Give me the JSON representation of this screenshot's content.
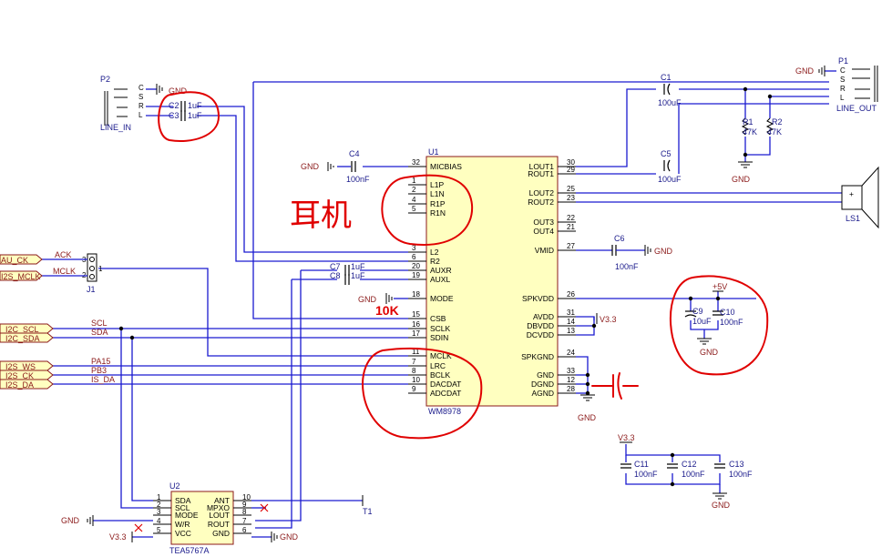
{
  "u1": {
    "ref": "U1",
    "name": "WM8978",
    "left_pins": [
      {
        "num": "32",
        "name": "MICBIAS"
      },
      {
        "num": "1",
        "name": "L1P"
      },
      {
        "num": "2",
        "name": "L1N"
      },
      {
        "num": "4",
        "name": "R1P"
      },
      {
        "num": "5",
        "name": "R1N"
      },
      {
        "num": "3",
        "name": "L2"
      },
      {
        "num": "6",
        "name": "R2"
      },
      {
        "num": "20",
        "name": "AUXR"
      },
      {
        "num": "19",
        "name": "AUXL"
      },
      {
        "num": "18",
        "name": "MODE"
      },
      {
        "num": "15",
        "name": "CSB"
      },
      {
        "num": "16",
        "name": "SCLK"
      },
      {
        "num": "17",
        "name": "SDIN"
      },
      {
        "num": "11",
        "name": "MCLK"
      },
      {
        "num": "7",
        "name": "LRC"
      },
      {
        "num": "8",
        "name": "BCLK"
      },
      {
        "num": "10",
        "name": "DACDAT"
      },
      {
        "num": "9",
        "name": "ADCDAT"
      }
    ],
    "right_pins": [
      {
        "num": "30",
        "name": "LOUT1"
      },
      {
        "num": "29",
        "name": "ROUT1"
      },
      {
        "num": "25",
        "name": "LOUT2"
      },
      {
        "num": "23",
        "name": "ROUT2"
      },
      {
        "num": "22",
        "name": "OUT3"
      },
      {
        "num": "21",
        "name": "OUT4"
      },
      {
        "num": "27",
        "name": "VMID"
      },
      {
        "num": "26",
        "name": "SPKVDD"
      },
      {
        "num": "31",
        "name": "AVDD"
      },
      {
        "num": "14",
        "name": "DBVDD"
      },
      {
        "num": "13",
        "name": "DCVDD"
      },
      {
        "num": "24",
        "name": "SPKGND"
      },
      {
        "num": "33",
        "name": "GND"
      },
      {
        "num": "12",
        "name": "DGND"
      },
      {
        "num": "28",
        "name": "AGND"
      }
    ]
  },
  "u2": {
    "ref": "U2",
    "name": "TEA5767A",
    "left_pins": [
      {
        "num": "1",
        "name": "SDA"
      },
      {
        "num": "2",
        "name": "SCL"
      },
      {
        "num": "3",
        "name": "MODE"
      },
      {
        "num": "4",
        "name": "W/R"
      },
      {
        "num": "5",
        "name": "VCC"
      }
    ],
    "right_pins": [
      {
        "num": "10",
        "name": "ANT"
      },
      {
        "num": "9",
        "name": "MPXO"
      },
      {
        "num": "8",
        "name": "LOUT"
      },
      {
        "num": "7",
        "name": "ROUT"
      },
      {
        "num": "6",
        "name": "GND"
      }
    ]
  },
  "components": {
    "c1": {
      "ref": "C1",
      "val": "100uF"
    },
    "c5": {
      "ref": "C5",
      "val": "100uF"
    },
    "c2": {
      "ref": "C2",
      "val": "1uF"
    },
    "c3": {
      "ref": "C3",
      "val": "1uF"
    },
    "c4": {
      "ref": "C4",
      "val": "100nF"
    },
    "c6": {
      "ref": "C6",
      "val": "100nF"
    },
    "c7": {
      "ref": "C7",
      "val": "1uF"
    },
    "c8": {
      "ref": "C8",
      "val": "1uF"
    },
    "c9": {
      "ref": "C9",
      "val": "10uF"
    },
    "c10": {
      "ref": "C10",
      "val": "100nF"
    },
    "c11": {
      "ref": "C11",
      "val": "100nF"
    },
    "c12": {
      "ref": "C12",
      "val": "100nF"
    },
    "c13": {
      "ref": "C13",
      "val": "100nF"
    },
    "r1": {
      "ref": "R1",
      "val": "47K"
    },
    "r2": {
      "ref": "R2",
      "val": "47K"
    },
    "p1": {
      "ref": "P1",
      "name": "LINE_OUT",
      "pins": [
        "C",
        "S",
        "R",
        "L"
      ]
    },
    "p2": {
      "ref": "P2",
      "name": "LINE_IN",
      "pins": [
        "C",
        "S",
        "R",
        "L"
      ]
    },
    "j1": {
      "ref": "J1",
      "pins": [
        "3",
        "2",
        "1"
      ]
    },
    "ls1": {
      "ref": "LS1",
      "plus": "+"
    },
    "t1": {
      "ref": "T1"
    }
  },
  "nets": {
    "gnd": "GND",
    "v33": "V3.3",
    "p5v": "+5V",
    "ack": "ACK",
    "mclk": "MCLK",
    "scl": "SCL",
    "sda": "SDA",
    "pa15": "PA15",
    "pb3": "PB3",
    "is_da": "IS_DA",
    "ports": [
      "AU_CK",
      "I2S_MCLK",
      "I2C_SCL",
      "I2C_SDA",
      "I2S_WS",
      "I2S_CK",
      "I2S_DA"
    ]
  },
  "annotations": {
    "earphone": "耳机",
    "res": "10K"
  }
}
